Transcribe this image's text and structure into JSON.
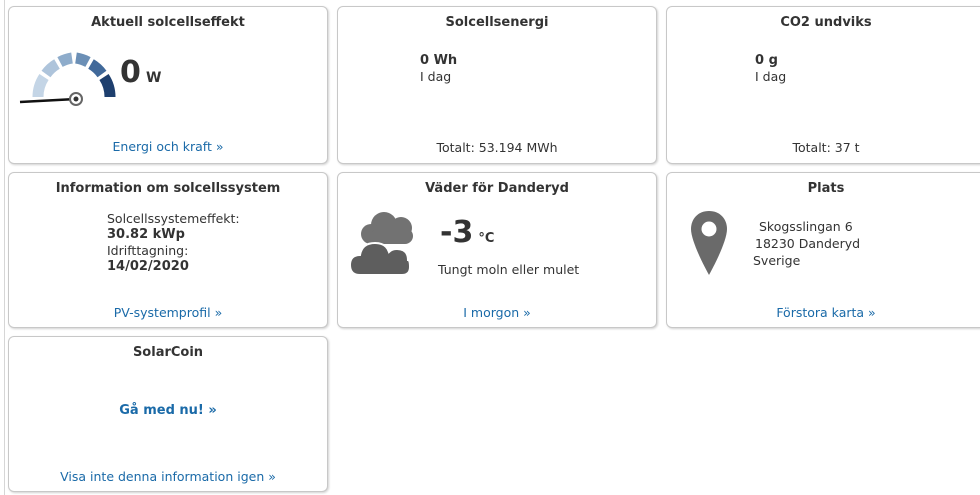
{
  "power_card": {
    "title": "Aktuell solcellseffekt",
    "value": "0",
    "unit": "W",
    "link": "Energi och kraft »",
    "gauge_level": 0
  },
  "energy_card": {
    "title": "Solcellsenergi",
    "value": "0 Wh",
    "period": "I dag",
    "total": "Totalt: 53.194 MWh"
  },
  "co2_card": {
    "title": "CO2 undviks",
    "value": "0 g",
    "period": "I dag",
    "total": "Totalt: 37 t"
  },
  "system_card": {
    "title": "Information om solcellssystem",
    "power_label": "Solcellssystemeffekt:",
    "power_value": "30.82 kWp",
    "commission_label": "Idrifttagning:",
    "commission_value": "14/02/2020",
    "link": "PV-systemprofil »"
  },
  "weather_card": {
    "title": "Väder för Danderyd",
    "temperature": "-3",
    "unit": "°C",
    "description": "Tungt moln eller mulet",
    "link": "I morgon »",
    "icon": "cloud-icon"
  },
  "location_card": {
    "title": "Plats",
    "street": "Skogsslingan 6",
    "postal": "18230 Danderyd",
    "country": "Sverige",
    "link": "Förstora karta »",
    "icon": "map-pin-icon"
  },
  "solarcoin_card": {
    "title": "SolarCoin",
    "join": "Gå med nu! »",
    "dismiss": "Visa inte denna information igen »"
  },
  "colors": {
    "link": "#1a6aa8",
    "gauge_dark": "#1e3f6e",
    "gauge_light": "#b9cde0",
    "icon_gray": "#707070"
  }
}
